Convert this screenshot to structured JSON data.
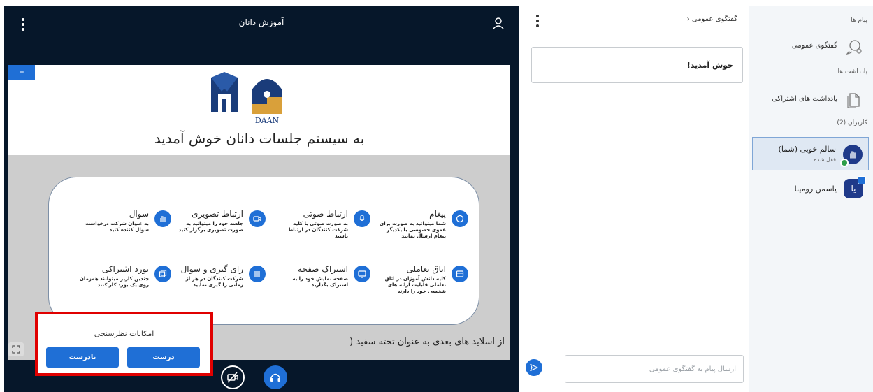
{
  "presentation": {
    "title": "آموزش دانان",
    "welcome_text": "به سیستم جلسات دانان خوش آمدید",
    "logo_text": "DAAN",
    "slide_note": "از اسلاید های بعدی به عنوان تخته سفید (",
    "features": [
      {
        "title": "پیغام",
        "desc": "شما میتوانید به صورت برای عموی خصوصی با یکدیگر پیغام ارسال نمایید",
        "icon": "chat-icon"
      },
      {
        "title": "ارتباط صوتی",
        "desc": "به صورت صوتی با کلیه شرکت کنندگان در ارتباط باشید",
        "icon": "microphone-icon"
      },
      {
        "title": "ارتباط تصویری",
        "desc": "جلسه خود را میتوانید به صورت تصویری برگزار کنید",
        "icon": "video-icon"
      },
      {
        "title": "سوال",
        "desc": "به عنوان شرکت درخواست سوال کننده کنید",
        "icon": "hand-icon"
      },
      {
        "title": "اتاق تعاملی",
        "desc": "کلیه دانش آموزان در اتاق تعاملی قابلیت ارائه های شخصی خود را دارند",
        "icon": "room-icon"
      },
      {
        "title": "اشتراک صفحه",
        "desc": "صفحه نمایش خود را به اشتراک بگذارید",
        "icon": "monitor-icon"
      },
      {
        "title": "رای گیری و سوال",
        "desc": "شرکت کنندگان در هر از زمانی را گیری نمایید",
        "icon": "list-icon"
      },
      {
        "title": "بورد اشتراکی",
        "desc": "چندین کاربر میتوانند همزمان روی یک بورد کار کنند",
        "icon": "board-icon"
      }
    ]
  },
  "poll": {
    "title": "امکانات نظرسنجی",
    "true_label": "درست",
    "false_label": "نادرست"
  },
  "chat": {
    "back_label": "گفتگوی عمومی",
    "welcome_message": "خوش آمدید!",
    "input_placeholder": "ارسال پیام به گفتگوی عمومی"
  },
  "sidebar": {
    "messages_heading": "پیام ها",
    "public_chat_label": "گفتگوی عمومی",
    "notes_heading": "یادداشت ها",
    "shared_notes_label": "یادداشت های اشتراکی",
    "users_heading": "کاربران (2)",
    "users": [
      {
        "name": "سالم خوبی (شما)",
        "status": "قفل شده"
      },
      {
        "name": "یاسمن رومینا",
        "initials": "یا"
      }
    ]
  },
  "colors": {
    "accent": "#1f6fd6",
    "dark_bg": "#06172a",
    "highlight_border": "#e00000",
    "sidebar_bg": "#f3f6f9"
  }
}
